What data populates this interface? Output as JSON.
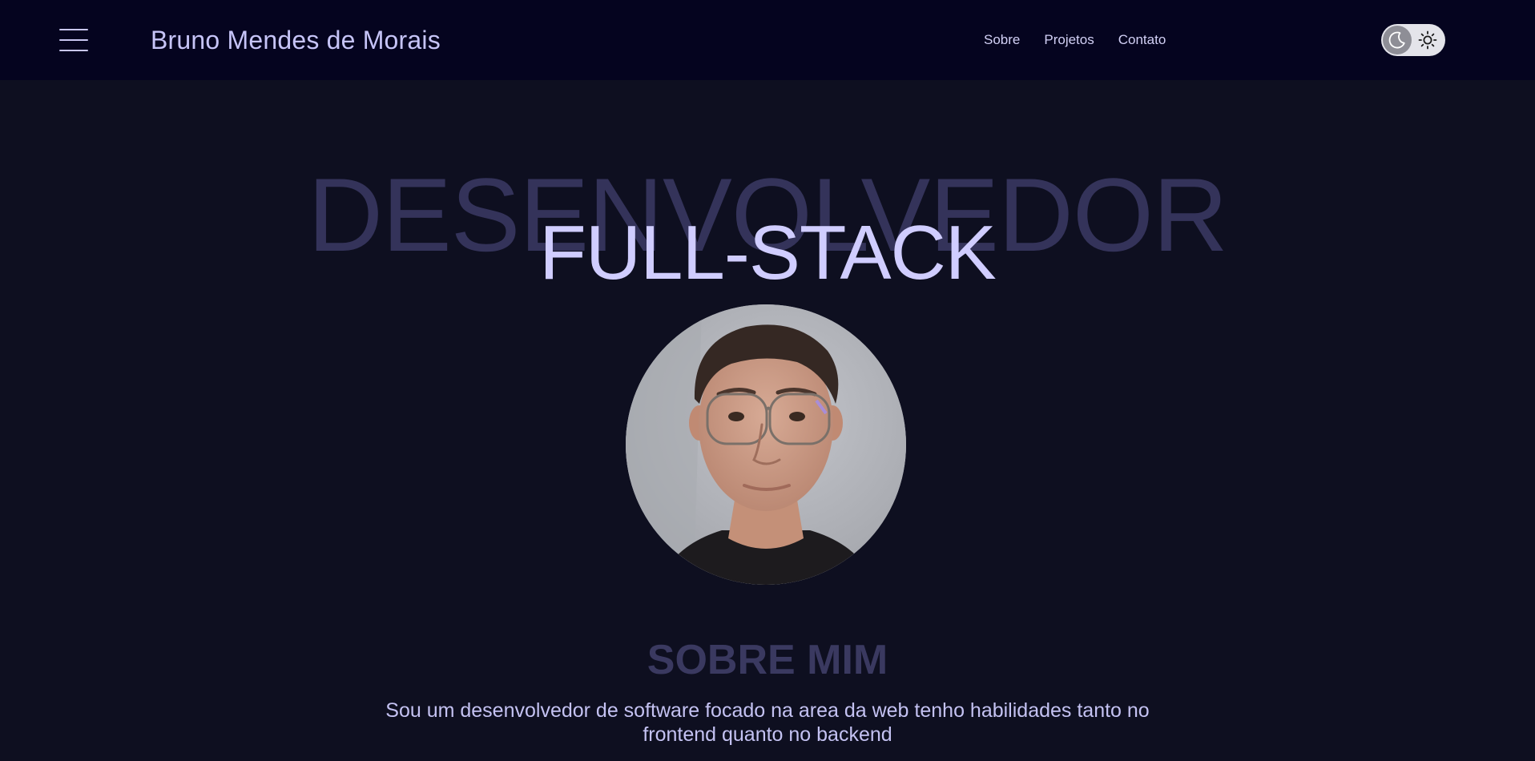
{
  "header": {
    "brand_name": "Bruno Mendes de Morais",
    "nav": [
      {
        "label": "Sobre"
      },
      {
        "label": "Projetos"
      },
      {
        "label": "Contato"
      }
    ],
    "theme_toggle": {
      "active_mode": "dark",
      "icons": [
        "moon-icon",
        "sun-icon"
      ]
    }
  },
  "hero": {
    "background_word": "DESENVOLVEDOR",
    "foreground_word": "FULL-STACK"
  },
  "about": {
    "title": "SOBRE MIM",
    "text": "Sou um desenvolvedor de software focado na area da web tenho habilidades tanto no frontend quanto no backend"
  },
  "colors": {
    "page_background": "#0e0f20",
    "navbar_background": "#05041f",
    "accent_text": "#d0cdff",
    "muted_text": "#34335a"
  }
}
